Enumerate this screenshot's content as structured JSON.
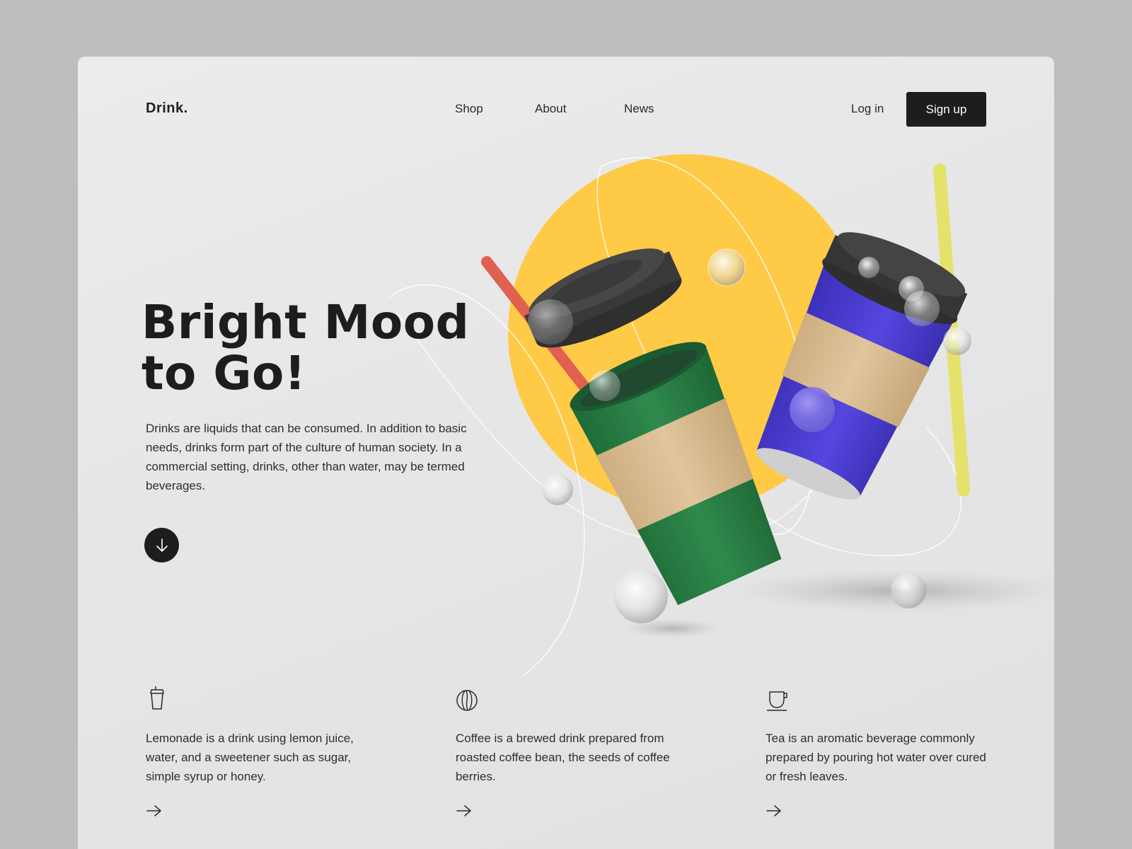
{
  "brand": {
    "logo": "Drink."
  },
  "nav": {
    "items": [
      {
        "label": "Shop"
      },
      {
        "label": "About"
      },
      {
        "label": "News"
      }
    ]
  },
  "auth": {
    "login_label": "Log in",
    "signup_label": "Sign up"
  },
  "hero": {
    "headline_line1": "Bright Mood",
    "headline_line2": "to Go!",
    "description": "Drinks are liquids that can be consumed. In addition to basic needs, drinks form part of the culture of human society. In a commercial setting, drinks, other than water, may be termed beverages.",
    "scroll_icon": "arrow-down-icon"
  },
  "features": [
    {
      "icon": "takeaway-cup-icon",
      "text": "Lemonade is a drink using lemon juice, water, and a sweetener such as sugar, simple syrup or honey.",
      "link_icon": "arrow-right-icon"
    },
    {
      "icon": "coffee-bean-icon",
      "text": "Coffee is a brewed drink prepared from roasted coffee bean, the seeds of coffee berries.",
      "link_icon": "arrow-right-icon"
    },
    {
      "icon": "tea-cup-icon",
      "text": "Tea is an aromatic beverage commonly prepared by pouring hot water over cured or fresh leaves.",
      "link_icon": "arrow-right-icon"
    }
  ],
  "colors": {
    "page_background": "#bdbdbd",
    "card_background": "#e8e8e8",
    "accent_yellow": "#ffca45",
    "cup_green": "#2a7d45",
    "cup_purple": "#4d3fd3",
    "sleeve_kraft": "#d7b98e",
    "lid_dark": "#3a3a3a",
    "straw_red": "#e06150",
    "straw_yellow": "#e4e26a",
    "button_dark": "#1d1d1d"
  }
}
